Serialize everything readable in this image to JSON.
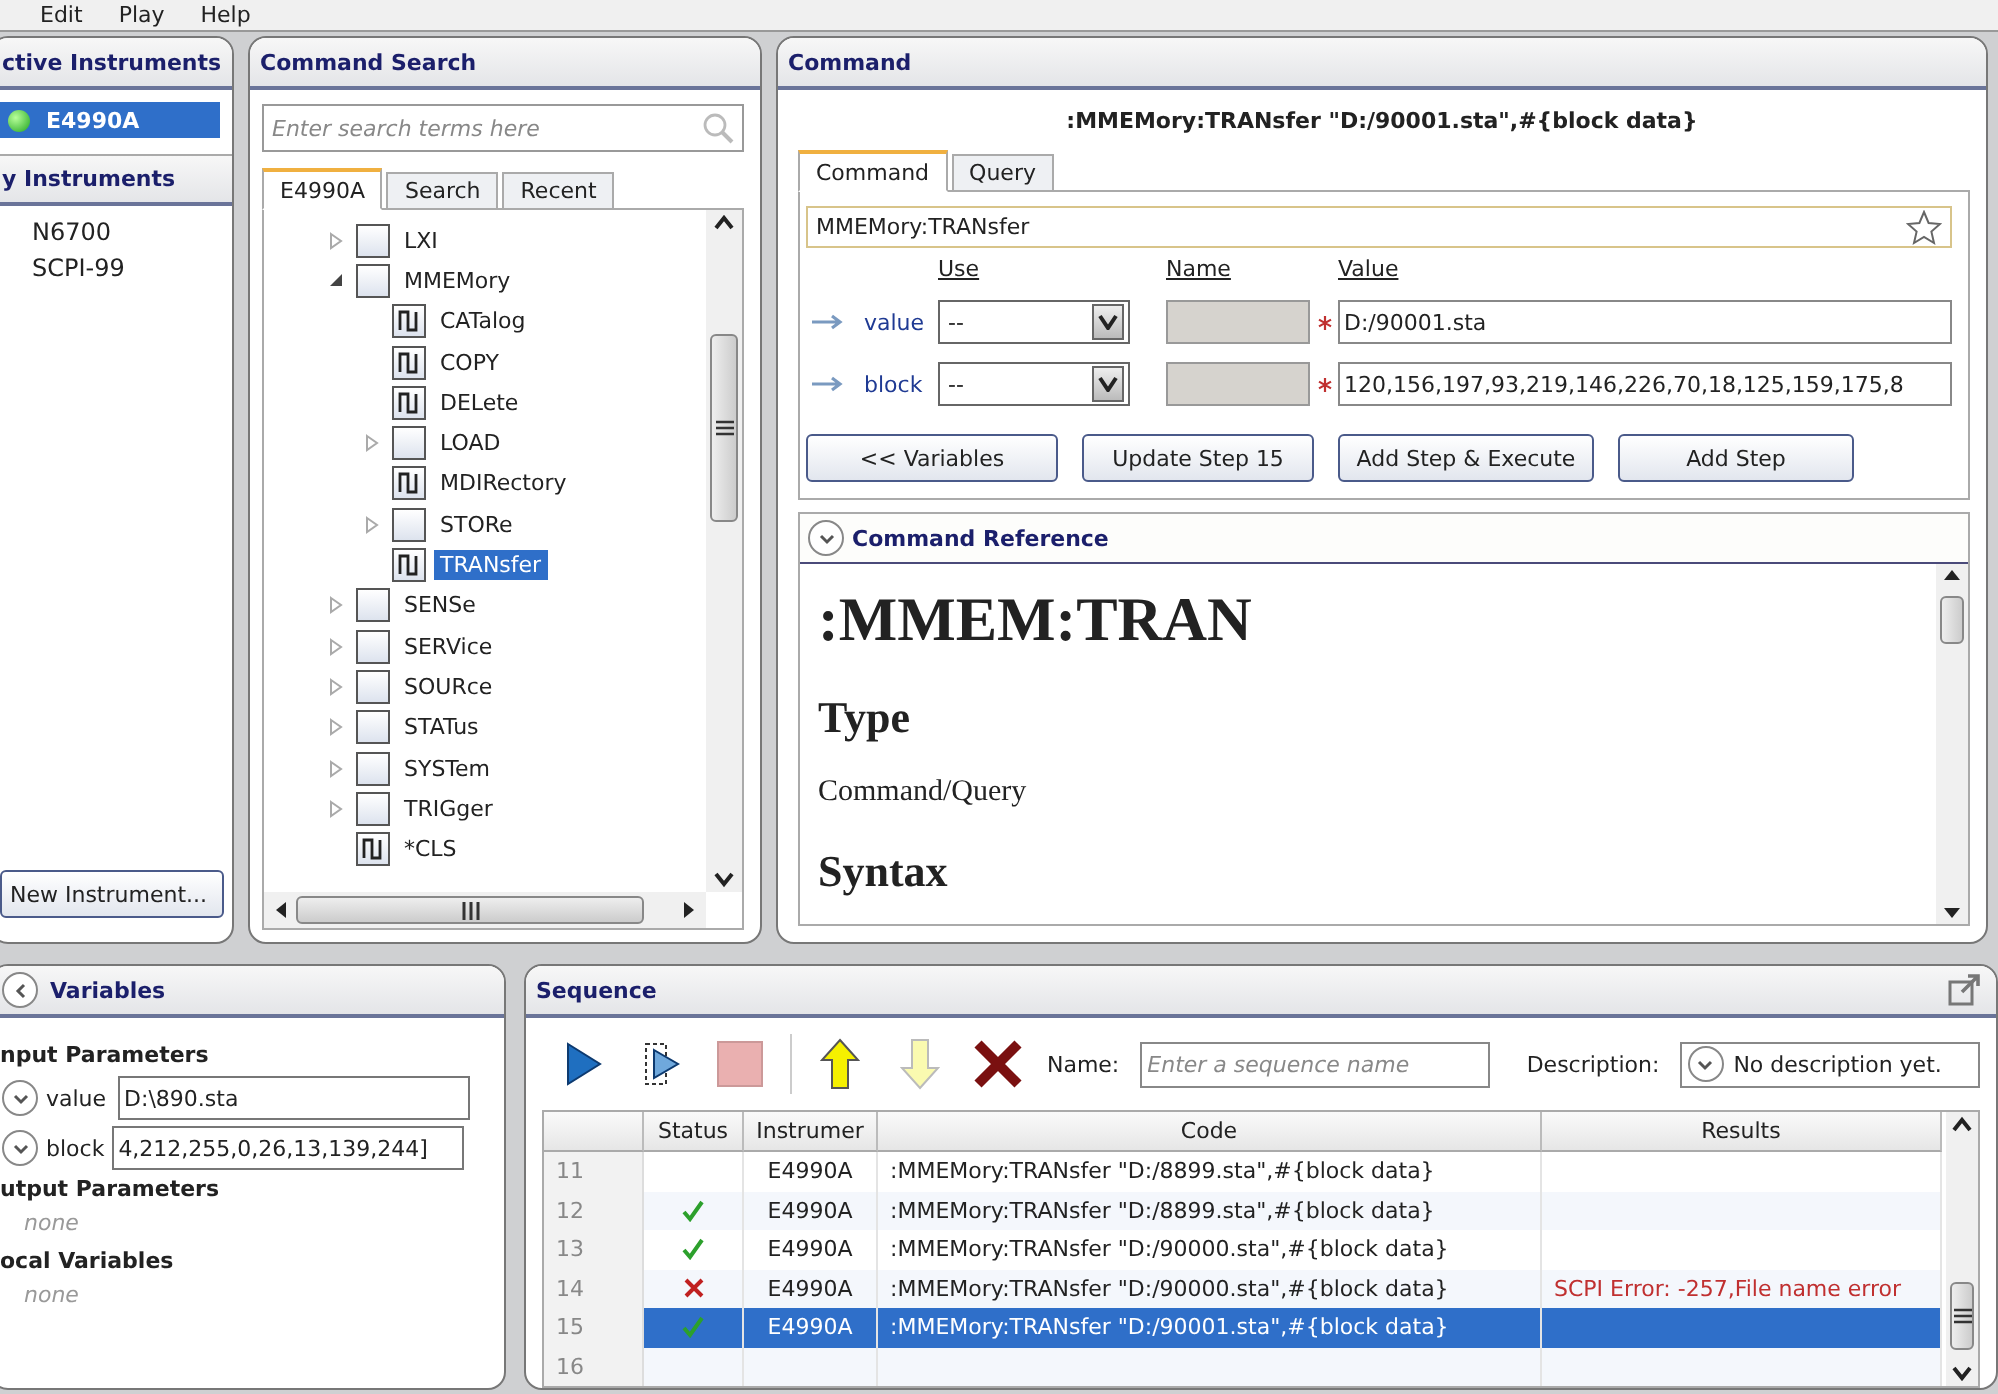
{
  "menu": [
    "Edit",
    "Play",
    "Help"
  ],
  "active_instruments": {
    "title": "ctive Instruments",
    "items": [
      {
        "label": "E4990A",
        "connected": true,
        "selected": true
      }
    ]
  },
  "my_instruments": {
    "title": "y Instruments",
    "items": [
      "N6700",
      "SCPI-99"
    ],
    "button": "New Instrument..."
  },
  "command_search": {
    "title": "Command Search",
    "placeholder": "Enter search terms here",
    "tabs": [
      {
        "label": "E4990A",
        "selected": true
      },
      {
        "label": "Search",
        "selected": false
      },
      {
        "label": "Recent",
        "selected": false
      }
    ],
    "tree": [
      {
        "label": "LXI",
        "kind": "folder",
        "expanded": false,
        "selected": false
      },
      {
        "label": "MMEMory",
        "kind": "folder",
        "expanded": true,
        "selected": false,
        "children": [
          {
            "label": "CATalog",
            "kind": "command",
            "selected": false
          },
          {
            "label": "COPY",
            "kind": "command",
            "selected": false
          },
          {
            "label": "DELete",
            "kind": "command",
            "selected": false
          },
          {
            "label": "LOAD",
            "kind": "folder",
            "expanded": false,
            "selected": false
          },
          {
            "label": "MDIRectory",
            "kind": "command",
            "selected": false
          },
          {
            "label": "STORe",
            "kind": "folder",
            "expanded": false,
            "selected": false
          },
          {
            "label": "TRANsfer",
            "kind": "command",
            "selected": true
          }
        ]
      },
      {
        "label": "SENSe",
        "kind": "folder",
        "expanded": false,
        "selected": false
      },
      {
        "label": "SERVice",
        "kind": "folder",
        "expanded": false,
        "selected": false
      },
      {
        "label": "SOURce",
        "kind": "folder",
        "expanded": false,
        "selected": false
      },
      {
        "label": "STATus",
        "kind": "folder",
        "expanded": false,
        "selected": false
      },
      {
        "label": "SYSTem",
        "kind": "folder",
        "expanded": false,
        "selected": false
      },
      {
        "label": "TRIGger",
        "kind": "folder",
        "expanded": false,
        "selected": false
      },
      {
        "label": "*CLS",
        "kind": "command",
        "selected": false
      }
    ]
  },
  "command": {
    "title": "Command",
    "full_command": ":MMEMory:TRANsfer \"D:/90001.sta\",#{block data}",
    "tabs": [
      {
        "label": "Command",
        "selected": true
      },
      {
        "label": "Query",
        "selected": false
      }
    ],
    "command_field": "MMEMory:TRANsfer",
    "columns": [
      "Use",
      "Name",
      "Value"
    ],
    "params": [
      {
        "name": "value",
        "use": "--",
        "required": true,
        "value": "D:/90001.sta"
      },
      {
        "name": "block",
        "use": "--",
        "required": true,
        "value": "120,156,197,93,219,146,226,70,18,125,159,175,8"
      }
    ],
    "buttons": [
      "<< Variables",
      "Update Step 15",
      "Add Step & Execute",
      "Add Step"
    ],
    "reference": {
      "title": "Command Reference",
      "heading": ":MMEM:TRAN",
      "sections": [
        {
          "heading": "Type",
          "body": "Command/Query"
        },
        {
          "heading": "Syntax"
        }
      ]
    }
  },
  "variables": {
    "title": "Variables",
    "input_title": "nput Parameters",
    "inputs": [
      {
        "name": "value",
        "value": "D:\\890.sta"
      },
      {
        "name": "block",
        "value": "4,212,255,0,26,13,139,244]"
      }
    ],
    "output_title": "utput Parameters",
    "output_none": "none",
    "local_title": "ocal Variables",
    "local_none": "none"
  },
  "sequence": {
    "title": "Sequence",
    "name_label": "Name:",
    "name_placeholder": "Enter a sequence name",
    "description_label": "Description:",
    "description": "No description yet.",
    "columns": [
      "Status",
      "Instrumer",
      "Code",
      "Results"
    ],
    "rows": [
      {
        "number": "11",
        "kind": "pending",
        "instrument": "E4990A",
        "code": ":MMEMory:TRANsfer \"D:/8899.sta\",#{block data}",
        "results": "",
        "selected": false
      },
      {
        "number": "12",
        "kind": "passed",
        "instrument": "E4990A",
        "code": ":MMEMory:TRANsfer \"D:/8899.sta\",#{block data}",
        "results": "",
        "selected": false
      },
      {
        "number": "13",
        "kind": "passed",
        "instrument": "E4990A",
        "code": ":MMEMory:TRANsfer \"D:/90000.sta\",#{block data}",
        "results": "",
        "selected": false
      },
      {
        "number": "14",
        "kind": "failed",
        "instrument": "E4990A",
        "code": ":MMEMory:TRANsfer \"D:/90000.sta\",#{block data}",
        "results": "SCPI Error: -257,File name error",
        "selected": false
      },
      {
        "number": "15",
        "kind": "passed",
        "instrument": "E4990A",
        "code": ":MMEMory:TRANsfer \"D:/90001.sta\",#{block data}",
        "results": "",
        "selected": true
      },
      {
        "number": "16",
        "kind": "pending",
        "instrument": "",
        "code": "",
        "results": "",
        "selected": false
      }
    ]
  }
}
